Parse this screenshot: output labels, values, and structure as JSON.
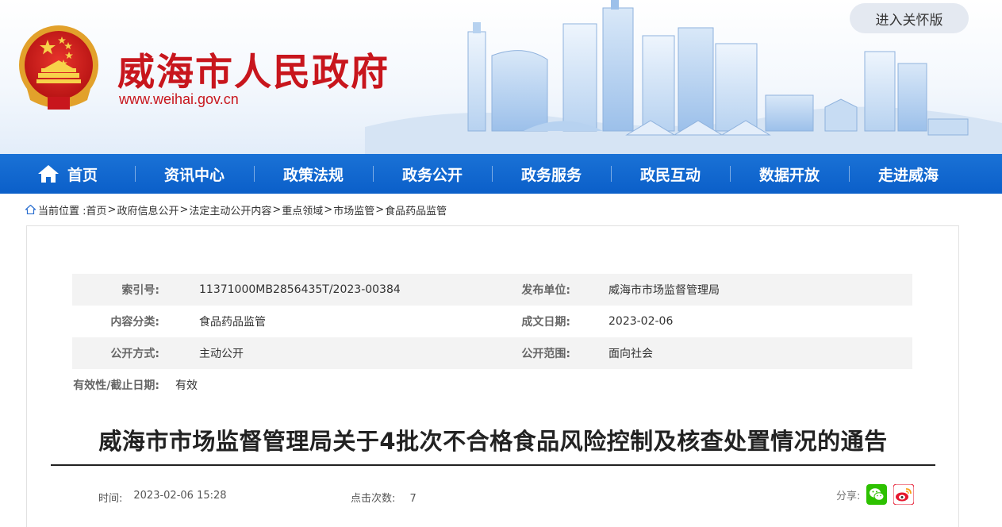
{
  "header": {
    "site_title": "威海市人民政府",
    "site_url": "www.weihai.gov.cn",
    "care_mode_label": "进入关怀版"
  },
  "nav": {
    "items": [
      "首页",
      "资讯中心",
      "政策法规",
      "政务公开",
      "政务服务",
      "政民互动",
      "数据开放",
      "走进威海"
    ]
  },
  "breadcrumb": {
    "prefix": "当前位置 :",
    "items": [
      "首页",
      "政府信息公开",
      "法定主动公开内容",
      "重点领域",
      "市场监管",
      "食品药品监管"
    ]
  },
  "meta": {
    "index_label": "索引号:",
    "index_value": "11371000MB2856435T/2023-00384",
    "publisher_label": "发布单位:",
    "publisher_value": "威海市市场监督管理局",
    "category_label": "内容分类:",
    "category_value": "食品药品监管",
    "date_label": "成文日期:",
    "date_value": "2023-02-06",
    "mode_label": "公开方式:",
    "mode_value": "主动公开",
    "scope_label": "公开范围:",
    "scope_value": "面向社会",
    "validity_label": "有效性/截止日期:",
    "validity_value": "有效"
  },
  "article": {
    "title": "威海市市场监督管理局关于4批次不合格食品风险控制及核查处置情况的通告",
    "time_label": "时间:",
    "time_value": "2023-02-06 15:28",
    "clicks_label": "点击次数:",
    "clicks_value": "7",
    "share_label": "分享:"
  },
  "colors": {
    "brand_red": "#c8161d",
    "nav_blue": "#0b5fc9"
  }
}
